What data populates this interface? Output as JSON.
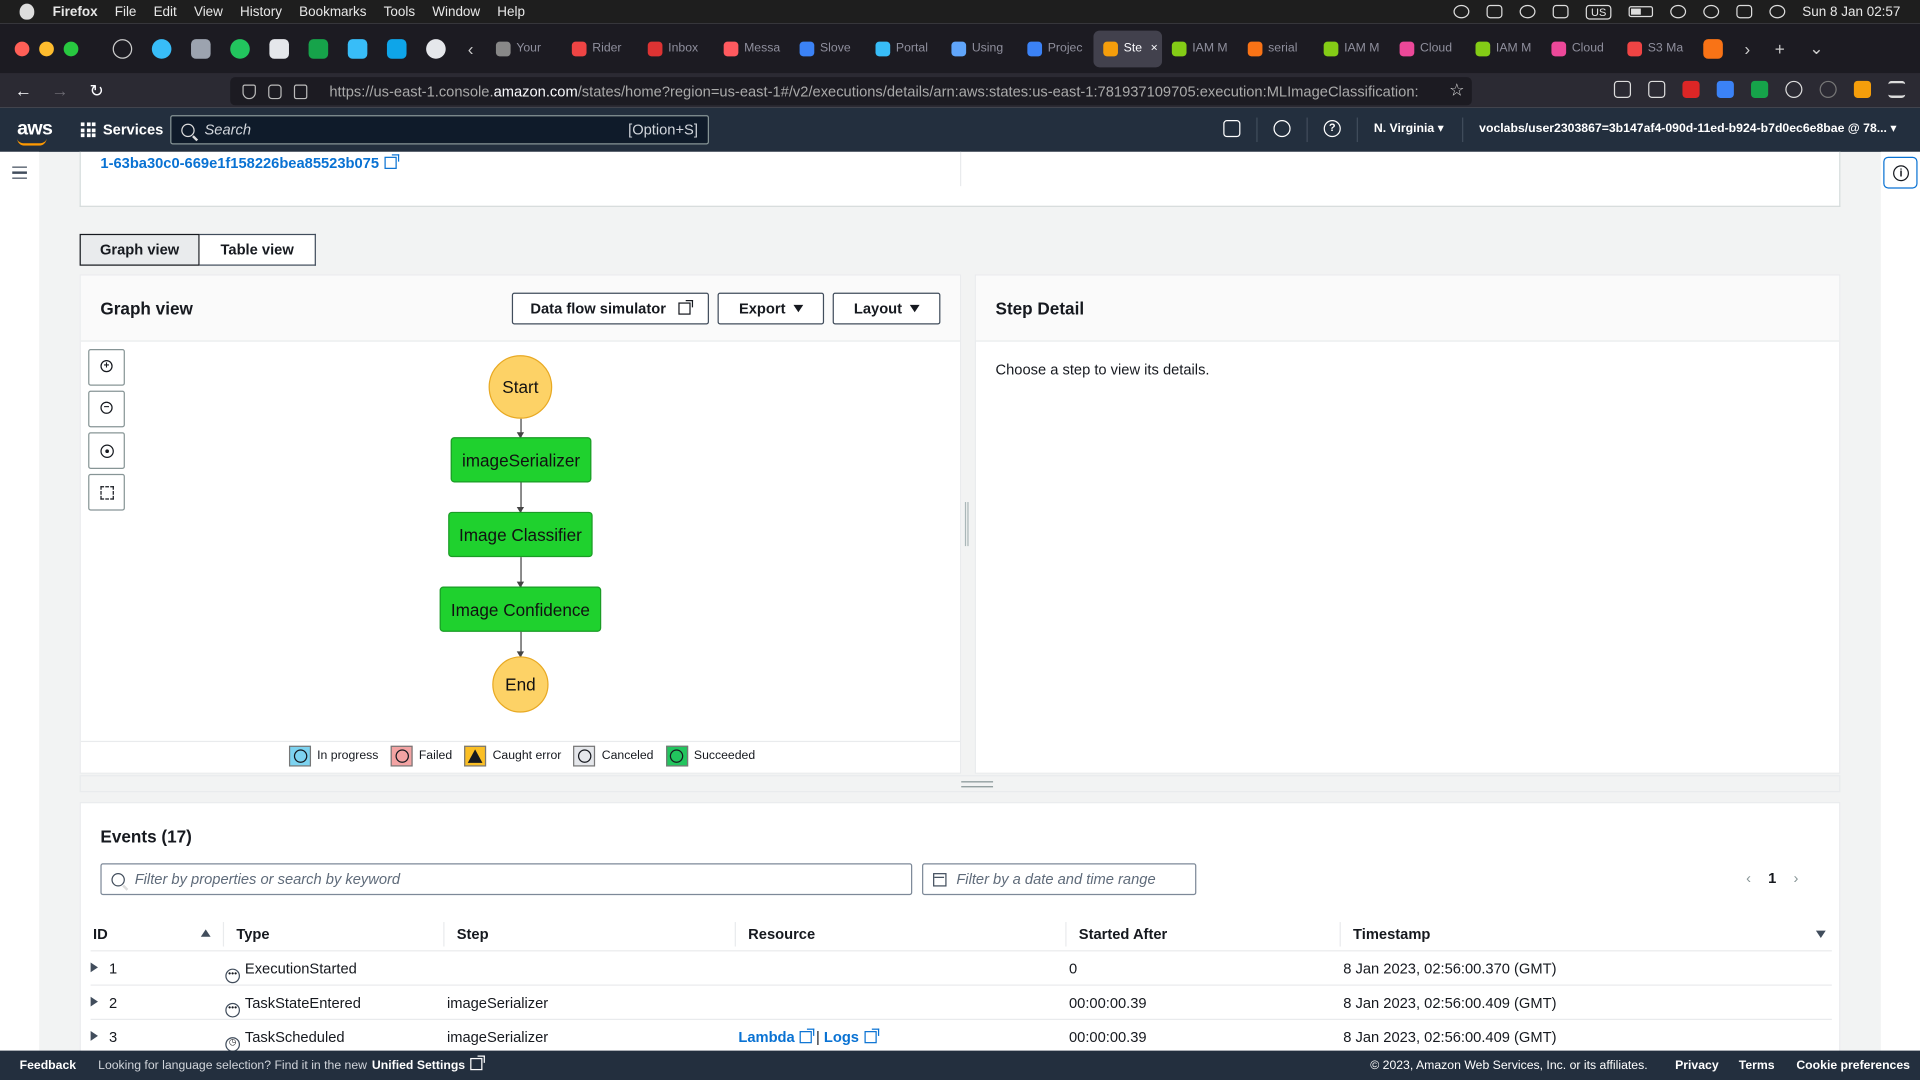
{
  "menubar": {
    "app": "Firefox",
    "items": [
      "File",
      "Edit",
      "View",
      "History",
      "Bookmarks",
      "Tools",
      "Window",
      "Help"
    ],
    "input_source": "US",
    "clock": "Sun 8 Jan  02:57"
  },
  "tabs": [
    {
      "label": "Your",
      "color": "#888"
    },
    {
      "label": "Rider",
      "color": "#e44"
    },
    {
      "label": "Inbox",
      "color": "#d33"
    },
    {
      "label": "Messa",
      "color": "#ff5a5f"
    },
    {
      "label": "Slove",
      "color": "#3b82f6"
    },
    {
      "label": "Portal",
      "color": "#38bdf8"
    },
    {
      "label": "Using",
      "color": "#60a5fa"
    },
    {
      "label": "Projec",
      "color": "#3b82f6"
    },
    {
      "label": "Ste",
      "color": "#f59e0b"
    },
    {
      "label": "IAM M",
      "color": "#84cc16"
    },
    {
      "label": "serial",
      "color": "#f97316"
    },
    {
      "label": "IAM M",
      "color": "#84cc16"
    },
    {
      "label": "Cloud",
      "color": "#ec4899"
    },
    {
      "label": "IAM M",
      "color": "#84cc16"
    },
    {
      "label": "Cloud",
      "color": "#ec4899"
    },
    {
      "label": "S3 Ma",
      "color": "#ef4444"
    }
  ],
  "browser": {
    "url_prefix": "https://us-east-1.console.",
    "url_host": "amazon.com",
    "url_rest": "/states/home?region=us-east-1#/v2/executions/details/arn:aws:states:us-east-1:781937109705:execution:MLImageClassification:"
  },
  "aws": {
    "logo": "aws",
    "services": "Services",
    "search_placeholder": "Search",
    "search_shortcut": "[Option+S]",
    "region": "N. Virginia",
    "user": "voclabs/user2303867=3b147af4-090d-11ed-b924-b7d0ec6e8bae @ 78..."
  },
  "execution": {
    "id_tail": "1-63ba30c0-669e1f158226bea85523b075"
  },
  "view_tabs": {
    "graph": "Graph view",
    "table": "Table view"
  },
  "graph": {
    "title": "Graph view",
    "data_flow": "Data flow simulator",
    "export": "Export",
    "layout": "Layout",
    "nodes": {
      "start": "Start",
      "n1": "imageSerializer",
      "n2": "Image Classifier",
      "n3": "Image Confidence",
      "end": "End"
    },
    "legend": [
      "In progress",
      "Failed",
      "Caught error",
      "Canceled",
      "Succeeded"
    ],
    "legend_colors": [
      "#7dd3f0",
      "#f3a3a3",
      "#fbbf24",
      "#e5e7eb",
      "#22c55e"
    ]
  },
  "step_detail": {
    "title": "Step Detail",
    "text": "Choose a step to view its details."
  },
  "events": {
    "title": "Events (17)",
    "filter_placeholder": "Filter by properties or search by keyword",
    "date_placeholder": "Filter by a date and time range",
    "page": "1",
    "columns": [
      "ID",
      "Type",
      "Step",
      "Resource",
      "Started After",
      "Timestamp"
    ],
    "rows": [
      {
        "id": "1",
        "type": "ExecutionStarted",
        "step": "",
        "resource": "",
        "resource2": "",
        "sep": "",
        "started": "0",
        "timestamp": "8 Jan 2023, 02:56:00.370 (GMT)"
      },
      {
        "id": "2",
        "type": "TaskStateEntered",
        "step": "imageSerializer",
        "resource": "",
        "resource2": "",
        "sep": "",
        "started": "00:00:00.39",
        "timestamp": "8 Jan 2023, 02:56:00.409 (GMT)"
      },
      {
        "id": "3",
        "type": "TaskScheduled",
        "step": "imageSerializer",
        "resource": "Lambda",
        "resource2": "Logs",
        "sep": "|",
        "started": "00:00:00.39",
        "timestamp": "8 Jan 2023, 02:56:00.409 (GMT)"
      }
    ]
  },
  "footer": {
    "feedback": "Feedback",
    "lang_text": "Looking for language selection? Find it in the new",
    "unified": "Unified Settings",
    "copyright": "© 2023, Amazon Web Services, Inc. or its affiliates.",
    "privacy": "Privacy",
    "terms": "Terms",
    "cookies": "Cookie preferences"
  }
}
